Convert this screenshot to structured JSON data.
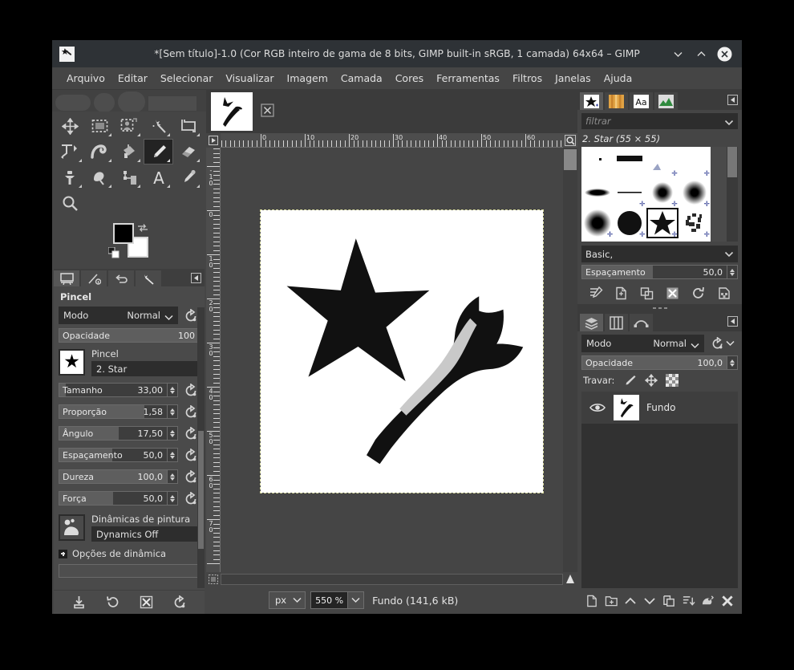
{
  "window": {
    "title": "*[Sem título]-1.0 (Cor RGB inteiro de gama de 8 bits, GIMP built-in sRGB, 1 camada) 64x64 – GIMP",
    "minimize_label": "Minimizar",
    "maximize_label": "Maximizar",
    "close_label": "Fechar"
  },
  "menubar": {
    "items": [
      {
        "label": "Arquivo"
      },
      {
        "label": "Editar"
      },
      {
        "label": "Selecionar"
      },
      {
        "label": "Visualizar"
      },
      {
        "label": "Imagem"
      },
      {
        "label": "Camada"
      },
      {
        "label": "Cores"
      },
      {
        "label": "Ferramentas"
      },
      {
        "label": "Filtros"
      },
      {
        "label": "Janelas"
      },
      {
        "label": "Ajuda"
      }
    ]
  },
  "toolbox": {
    "tools": [
      {
        "name": "move-tool"
      },
      {
        "name": "rectangle-select-tool"
      },
      {
        "name": "free-select-tool"
      },
      {
        "name": "fuzzy-select-tool"
      },
      {
        "name": "crop-tool"
      },
      {
        "name": "transform-tool"
      },
      {
        "name": "warp-tool"
      },
      {
        "name": "bucket-fill-tool"
      },
      {
        "name": "paintbrush-tool"
      },
      {
        "name": "eraser-tool"
      },
      {
        "name": "clone-tool"
      },
      {
        "name": "smudge-tool"
      },
      {
        "name": "path-tool"
      },
      {
        "name": "text-tool"
      },
      {
        "name": "color-picker-tool"
      },
      {
        "name": "zoom-tool"
      }
    ],
    "selected_tool": "paintbrush-tool",
    "foreground_color": "#000000",
    "background_color": "#ffffff"
  },
  "tool_options": {
    "title": "Pincel",
    "tabs": [
      "tool-options-tab",
      "device-status-tab",
      "undo-history-tab",
      "pointer-tab"
    ],
    "mode": {
      "label": "Modo",
      "value": "Normal"
    },
    "opacity": {
      "label": "Opacidade",
      "value": "100",
      "fill_pct": 100
    },
    "brush": {
      "caption": "Pincel",
      "value": "2. Star"
    },
    "sliders": [
      {
        "label": "Tamanho",
        "value": "33,00",
        "fill_pct": 6
      },
      {
        "label": "Proporção",
        "value": "1,58",
        "fill_pct": 79
      },
      {
        "label": "Ângulo",
        "value": "17,50",
        "fill_pct": 55
      },
      {
        "label": "Espaçamento",
        "value": "50,0",
        "fill_pct": 49
      },
      {
        "label": "Dureza",
        "value": "100,0",
        "fill_pct": 100
      },
      {
        "label": "Força",
        "value": "50,0",
        "fill_pct": 50
      }
    ],
    "dynamics": {
      "caption": "Dinâmicas de pintura",
      "value": "Dynamics Off"
    },
    "expander": {
      "label": "Opções de dinâmica"
    },
    "bottom_buttons": [
      "save-options-icon",
      "restore-options-icon",
      "delete-options-icon",
      "reset-options-icon"
    ]
  },
  "canvas": {
    "tab_name": "image-thumbnail-tab",
    "close_tab_label": "×",
    "hruler_ticks": [
      "0",
      "10",
      "20",
      "30",
      "40",
      "50",
      "60"
    ],
    "vruler_ticks": [
      "-10",
      "0",
      "10",
      "20",
      "30",
      "40",
      "50",
      "60",
      "70"
    ]
  },
  "statusbar": {
    "unit": "px",
    "zoom": "550 %",
    "status": "Fundo (141,6 kB)"
  },
  "brushes_panel": {
    "tabs": [
      "brushes-tab",
      "patterns-tab",
      "fonts-tab",
      "gradients-tab"
    ],
    "active_tab": "brushes-tab",
    "filter_placeholder": "filtrar",
    "selected_brush": "2. Star (55 × 55)",
    "tag_combo": "Basic,",
    "spacing": {
      "label": "Espaçamento",
      "value": "50,0",
      "fill_pct": 49
    },
    "buttons": [
      "edit-brush-icon",
      "new-brush-icon",
      "duplicate-brush-icon",
      "delete-brush-icon",
      "refresh-brushes-icon",
      "open-brush-as-image-icon"
    ],
    "grid": [
      {
        "name": "brush-pixel"
      },
      {
        "name": "brush-block"
      },
      {
        "name": "brush-empty"
      },
      {
        "name": "brush-acrylic"
      },
      {
        "name": "brush-ellipse-fuzzy"
      },
      {
        "name": "brush-line"
      },
      {
        "name": "brush-fuzzy-small"
      },
      {
        "name": "brush-fuzzy-medium"
      },
      {
        "name": "brush-fuzzy-large"
      },
      {
        "name": "brush-hardcircle"
      },
      {
        "name": "brush-star"
      },
      {
        "name": "brush-chalk"
      },
      {
        "name": "brush-splatter1"
      },
      {
        "name": "brush-splatter2"
      },
      {
        "name": "brush-soft-splatter"
      },
      {
        "name": "brush-splatter3"
      }
    ]
  },
  "layers_panel": {
    "tabs": [
      "layers-tab",
      "channels-tab",
      "paths-tab"
    ],
    "active_tab": "layers-tab",
    "mode": {
      "label": "Modo",
      "value": "Normal"
    },
    "opacity": {
      "label": "Opacidade",
      "value": "100,0",
      "fill_pct": 100
    },
    "lock_label": "Travar:",
    "lock_buttons": [
      "lock-pixels-icon",
      "lock-position-icon",
      "lock-alpha-icon"
    ],
    "layers": [
      {
        "name": "Fundo",
        "visible": true
      }
    ],
    "buttons": [
      "new-layer-icon",
      "new-layer-group-icon",
      "raise-layer-icon",
      "lower-layer-icon",
      "duplicate-layer-icon",
      "anchor-layer-icon",
      "merge-down-icon",
      "delete-layer-icon"
    ]
  },
  "colors": {
    "window_bg": "#454545",
    "titlebar_bg": "#2e3236",
    "panel_bg": "#4a4a4a",
    "entry_bg": "#2d2d2d",
    "text": "#e0e0e0",
    "desktop": "#000000"
  }
}
